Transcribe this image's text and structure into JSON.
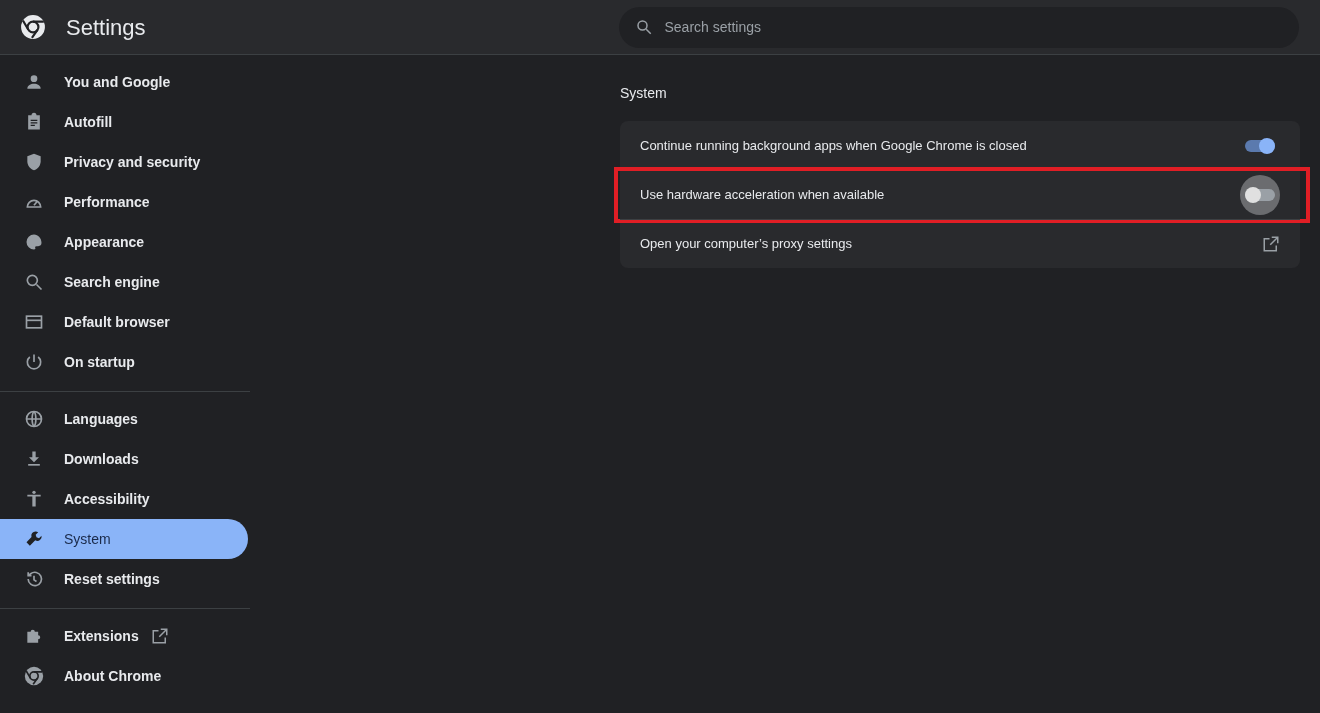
{
  "header": {
    "title": "Settings",
    "search": {
      "placeholder": "Search settings"
    }
  },
  "sidebar": {
    "groups": [
      {
        "items": [
          {
            "label": "You and Google",
            "selected": false,
            "external": false
          },
          {
            "label": "Autofill",
            "selected": false,
            "external": false
          },
          {
            "label": "Privacy and security",
            "selected": false,
            "external": false
          },
          {
            "label": "Performance",
            "selected": false,
            "external": false
          },
          {
            "label": "Appearance",
            "selected": false,
            "external": false
          },
          {
            "label": "Search engine",
            "selected": false,
            "external": false
          },
          {
            "label": "Default browser",
            "selected": false,
            "external": false
          },
          {
            "label": "On startup",
            "selected": false,
            "external": false
          }
        ]
      },
      {
        "items": [
          {
            "label": "Languages",
            "selected": false,
            "external": false
          },
          {
            "label": "Downloads",
            "selected": false,
            "external": false
          },
          {
            "label": "Accessibility",
            "selected": false,
            "external": false
          },
          {
            "label": "System",
            "selected": true,
            "external": false
          },
          {
            "label": "Reset settings",
            "selected": false,
            "external": false
          }
        ]
      },
      {
        "items": [
          {
            "label": "Extensions",
            "selected": false,
            "external": true
          },
          {
            "label": "About Chrome",
            "selected": false,
            "external": false
          }
        ]
      }
    ]
  },
  "section": {
    "title": "System",
    "rows": [
      {
        "kind": "toggle",
        "label": "Continue running background apps when Google Chrome is closed",
        "on": true,
        "focused": false,
        "highlighted": false
      },
      {
        "kind": "toggle",
        "label": "Use hardware acceleration when available",
        "on": false,
        "focused": true,
        "highlighted": true
      },
      {
        "kind": "link",
        "label": "Open your computer’s proxy settings",
        "highlighted": false
      }
    ]
  }
}
